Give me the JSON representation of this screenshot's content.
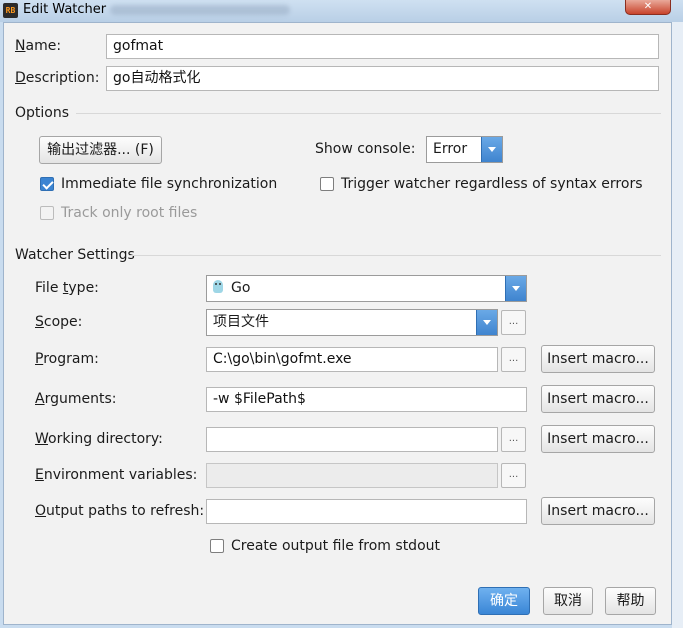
{
  "window": {
    "title": "Edit Watcher",
    "close_symbol": "✕"
  },
  "form": {
    "name_label": "Name:",
    "name_value": "gofmat",
    "description_label": "Description:",
    "description_value": "go自动格式化"
  },
  "options": {
    "section_title": "Options",
    "output_filter_button": "输出过滤器... (F)",
    "show_console_label": "Show console:",
    "show_console_value": "Error",
    "immediate_sync_label": "Immediate file synchronization",
    "immediate_sync_checked": true,
    "trigger_watcher_label": "Trigger watcher regardless of syntax errors",
    "trigger_watcher_checked": false,
    "track_root_label": "Track only root files",
    "track_root_checked": false
  },
  "watcher": {
    "section_title": "Watcher Settings",
    "file_type_label": "File type:",
    "file_type_value": "Go",
    "file_type_icon": "gopher-icon",
    "scope_label": "Scope:",
    "scope_value": "项目文件",
    "program_label": "Program:",
    "program_value": "C:\\go\\bin\\gofmt.exe",
    "arguments_label": "Arguments:",
    "arguments_value": "-w $FilePath$",
    "working_dir_label": "Working directory:",
    "working_dir_value": "",
    "env_vars_label": "Environment variables:",
    "env_vars_value": "",
    "output_paths_label": "Output paths to refresh:",
    "output_paths_value": "",
    "create_output_label": "Create output file from stdout",
    "create_output_checked": false,
    "insert_macro_label": "Insert macro...",
    "browse_label": "..."
  },
  "footer": {
    "ok_label": "确定",
    "cancel_label": "取消",
    "help_label": "帮助"
  },
  "colors": {
    "accent": "#3a86d6",
    "dialog_bg": "#f2f2f2",
    "close_red": "#c8432b"
  }
}
